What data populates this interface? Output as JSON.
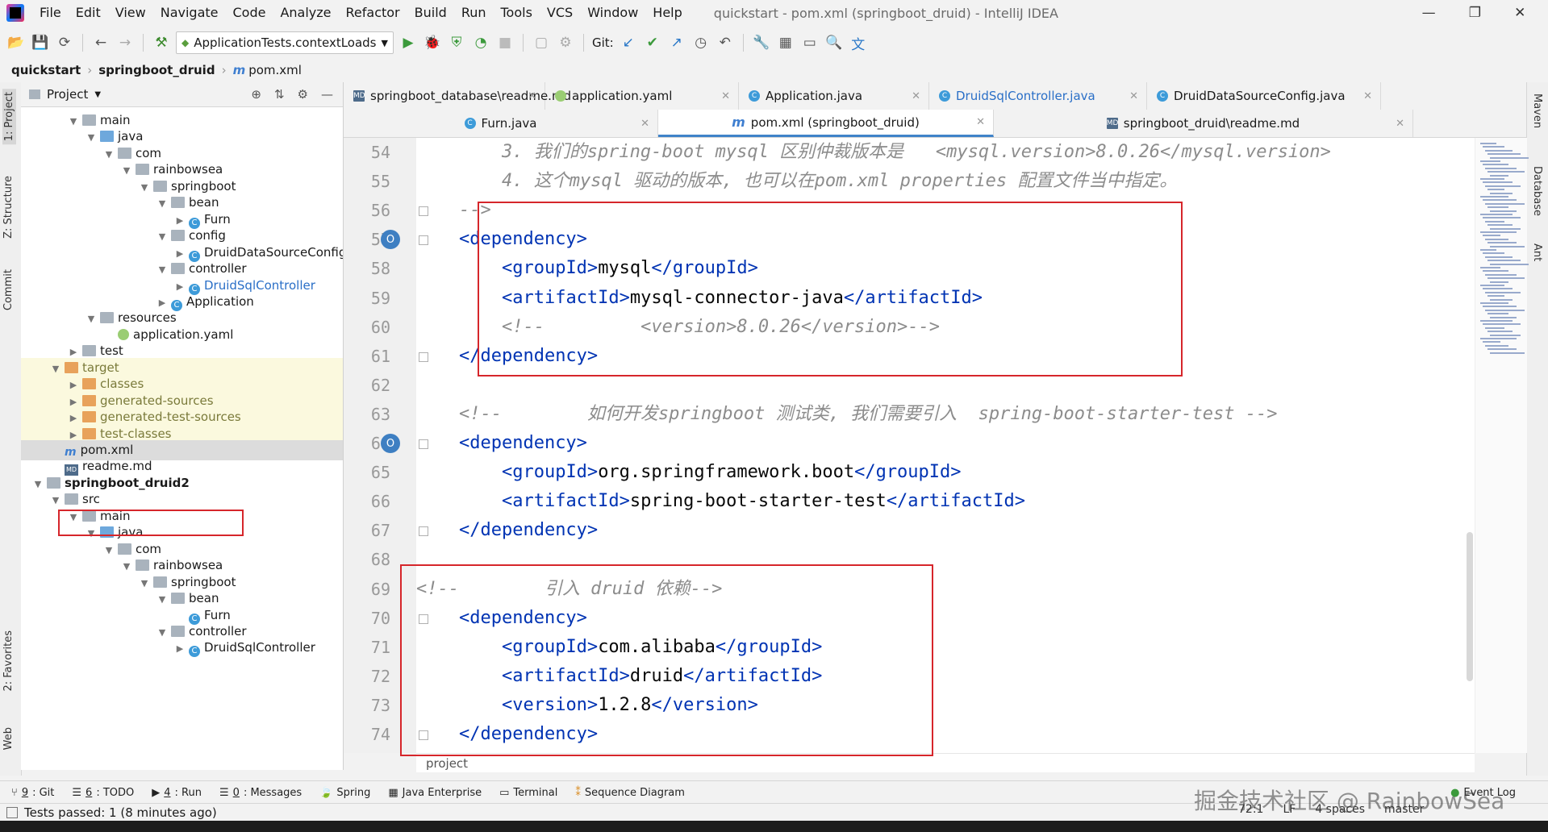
{
  "menubar": {
    "items": [
      "File",
      "Edit",
      "View",
      "Navigate",
      "Code",
      "Analyze",
      "Refactor",
      "Build",
      "Run",
      "Tools",
      "VCS",
      "Window",
      "Help"
    ],
    "title": "quickstart - pom.xml (springboot_druid) - IntelliJ IDEA",
    "minimize": "—",
    "restore": "❐",
    "close": "✕"
  },
  "toolbar": {
    "run_config": "ApplicationTests.contextLoads",
    "git_label": "Git:"
  },
  "breadcrumb": [
    "quickstart",
    "springboot_druid",
    "pom.xml"
  ],
  "left_stripe": {
    "project": "1: Project",
    "structure": "Z: Structure",
    "commit": "Commit",
    "favorites": "2: Favorites",
    "web": "Web"
  },
  "right_stripe": {
    "maven": "Maven",
    "database": "Database",
    "ant": "Ant"
  },
  "project_panel": {
    "title": "Project",
    "rows": [
      {
        "label": "main"
      },
      {
        "label": "java"
      },
      {
        "label": "com"
      },
      {
        "label": "rainbowsea"
      },
      {
        "label": "springboot"
      },
      {
        "label": "bean"
      },
      {
        "label": "Furn"
      },
      {
        "label": "config"
      },
      {
        "label": "DruidDataSourceConfig"
      },
      {
        "label": "controller"
      },
      {
        "label": "DruidSqlController"
      },
      {
        "label": "Application"
      },
      {
        "label": "resources"
      },
      {
        "label": "application.yaml"
      },
      {
        "label": "test"
      },
      {
        "label": "target"
      },
      {
        "label": "classes"
      },
      {
        "label": "generated-sources"
      },
      {
        "label": "generated-test-sources"
      },
      {
        "label": "test-classes"
      },
      {
        "label": "pom.xml"
      },
      {
        "label": "readme.md"
      },
      {
        "label": "springboot_druid2"
      },
      {
        "label": "src"
      },
      {
        "label": "main"
      },
      {
        "label": "java"
      },
      {
        "label": "com"
      },
      {
        "label": "rainbowsea"
      },
      {
        "label": "springboot"
      },
      {
        "label": "bean"
      },
      {
        "label": "Furn"
      },
      {
        "label": "controller"
      },
      {
        "label": "DruidSqlController"
      }
    ]
  },
  "tabs_row1": [
    "springboot_database\\readme.md",
    "application.yaml",
    "Application.java",
    "DruidSqlController.java",
    "DruidDataSourceConfig.java"
  ],
  "tabs_row2": [
    "Furn.java",
    "pom.xml (springboot_druid)",
    "springboot_druid\\readme.md"
  ],
  "editor": {
    "lines": [
      {
        "n": "54",
        "t": "        3. 我们的spring-boot mysql 区别仲裁版本是   <mysql.version>8.0.26</mysql.version>"
      },
      {
        "n": "55",
        "t": "        4. 这个mysql 驱动的版本, 也可以在pom.xml properties 配置文件当中指定。"
      },
      {
        "n": "56",
        "t": "    -->"
      },
      {
        "n": "57",
        "t": "    <dependency>"
      },
      {
        "n": "58",
        "t": "        <groupId>mysql</groupId>"
      },
      {
        "n": "59",
        "t": "        <artifactId>mysql-connector-java</artifactId>"
      },
      {
        "n": "60",
        "t": "        <!--         <version>8.0.26</version>-->"
      },
      {
        "n": "61",
        "t": "    </dependency>"
      },
      {
        "n": "62",
        "t": ""
      },
      {
        "n": "63",
        "t": "    <!--        如何开发springboot 测试类, 我们需要引入  spring-boot-starter-test -->"
      },
      {
        "n": "64",
        "t": "    <dependency>"
      },
      {
        "n": "65",
        "t": "        <groupId>org.springframework.boot</groupId>"
      },
      {
        "n": "66",
        "t": "        <artifactId>spring-boot-starter-test</artifactId>"
      },
      {
        "n": "67",
        "t": "    </dependency>"
      },
      {
        "n": "68",
        "t": ""
      },
      {
        "n": "69",
        "t": "<!--        引入 druid 依赖-->"
      },
      {
        "n": "70",
        "t": "    <dependency>"
      },
      {
        "n": "71",
        "t": "        <groupId>com.alibaba</groupId>"
      },
      {
        "n": "72",
        "t": "        <artifactId>druid</artifactId>"
      },
      {
        "n": "73",
        "t": "        <version>1.2.8</version>"
      },
      {
        "n": "74",
        "t": "    </dependency>"
      }
    ],
    "breadcrumb": "project"
  },
  "toolwindows": [
    {
      "num": "9",
      "label": ": Git"
    },
    {
      "num": "6",
      "label": ": TODO"
    },
    {
      "num": "4",
      "label": ": Run"
    },
    {
      "num": "0",
      "label": ": Messages"
    },
    {
      "num": "",
      "label": "Spring"
    },
    {
      "num": "",
      "label": "Java Enterprise"
    },
    {
      "num": "",
      "label": "Terminal"
    },
    {
      "num": "",
      "label": "Sequence Diagram"
    },
    {
      "num": "",
      "label": "Event Log"
    }
  ],
  "status": {
    "message": "Tests passed: 1 (8 minutes ago)",
    "position": "72:1",
    "line_sep": "LF",
    "indent": "4 spaces",
    "branch": "master"
  },
  "watermark": "掘金技术社区 @ RainbowSea"
}
